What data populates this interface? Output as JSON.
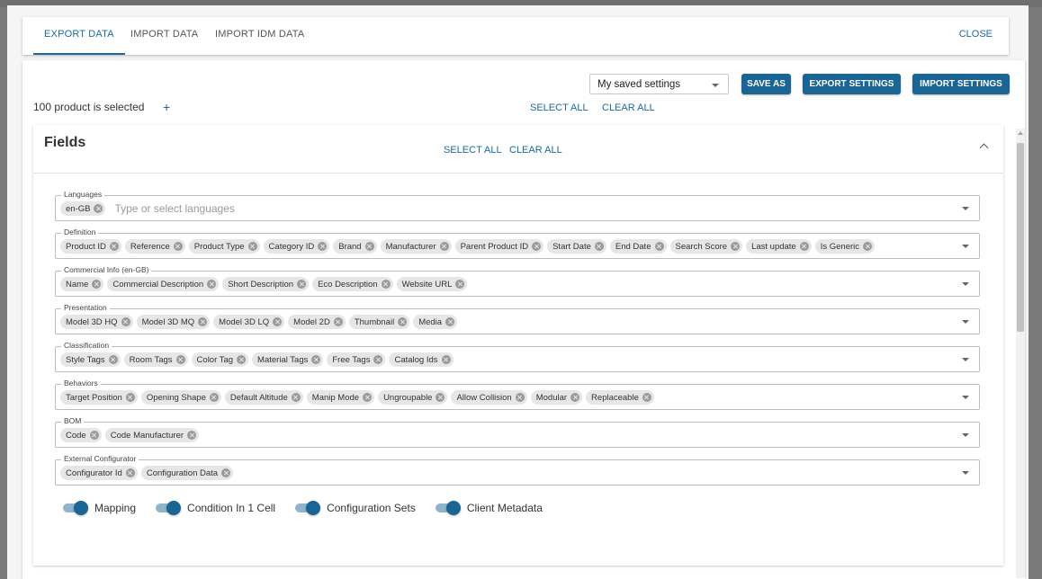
{
  "tabs": [
    {
      "label": "EXPORT DATA"
    },
    {
      "label": "IMPORT DATA"
    },
    {
      "label": "IMPORT IDM DATA"
    }
  ],
  "close_label": "CLOSE",
  "settings": {
    "selected": "My saved settings",
    "save_as": "SAVE AS",
    "export_settings": "EXPORT SETTINGS",
    "import_settings": "IMPORT SETTINGS"
  },
  "selection": {
    "count_text": "100 product is selected",
    "add": "+",
    "select_all": "SELECT ALL",
    "clear_all": "CLEAR ALL"
  },
  "fields": {
    "title": "Fields",
    "select_all": "SELECT ALL",
    "clear_all": "CLEAR ALL",
    "groups": [
      {
        "label": "Languages",
        "chips": [
          "en-GB"
        ],
        "placeholder": "Type or select languages"
      },
      {
        "label": "Definition",
        "chips": [
          "Product ID",
          "Reference",
          "Product Type",
          "Category ID",
          "Brand",
          "Manufacturer",
          "Parent Product ID",
          "Start Date",
          "End Date",
          "Search Score",
          "Last update",
          "Is Generic"
        ]
      },
      {
        "label": "Commercial Info (en-GB)",
        "chips": [
          "Name",
          "Commercial Description",
          "Short Description",
          "Eco Description",
          "Website URL"
        ]
      },
      {
        "label": "Presentation",
        "chips": [
          "Model 3D HQ",
          "Model 3D MQ",
          "Model 3D LQ",
          "Model 2D",
          "Thumbnail",
          "Media"
        ]
      },
      {
        "label": "Classification",
        "chips": [
          "Style Tags",
          "Room Tags",
          "Color Tag",
          "Material Tags",
          "Free Tags",
          "Catalog Ids"
        ]
      },
      {
        "label": "Behaviors",
        "chips": [
          "Target Position",
          "Opening Shape",
          "Default Altitude",
          "Manip Mode",
          "Ungroupable",
          "Allow Collision",
          "Modular",
          "Replaceable"
        ]
      },
      {
        "label": "BOM",
        "chips": [
          "Code",
          "Code Manufacturer"
        ]
      },
      {
        "label": "External Configurator",
        "chips": [
          "Configurator Id",
          "Configuration Data"
        ]
      }
    ],
    "toggles": [
      {
        "label": "Mapping",
        "on": true
      },
      {
        "label": "Condition In 1 Cell",
        "on": true
      },
      {
        "label": "Configuration Sets",
        "on": true
      },
      {
        "label": "Client Metadata",
        "on": true
      }
    ]
  },
  "colors": {
    "accent": "#1a6594",
    "link": "#1a6a9c"
  }
}
